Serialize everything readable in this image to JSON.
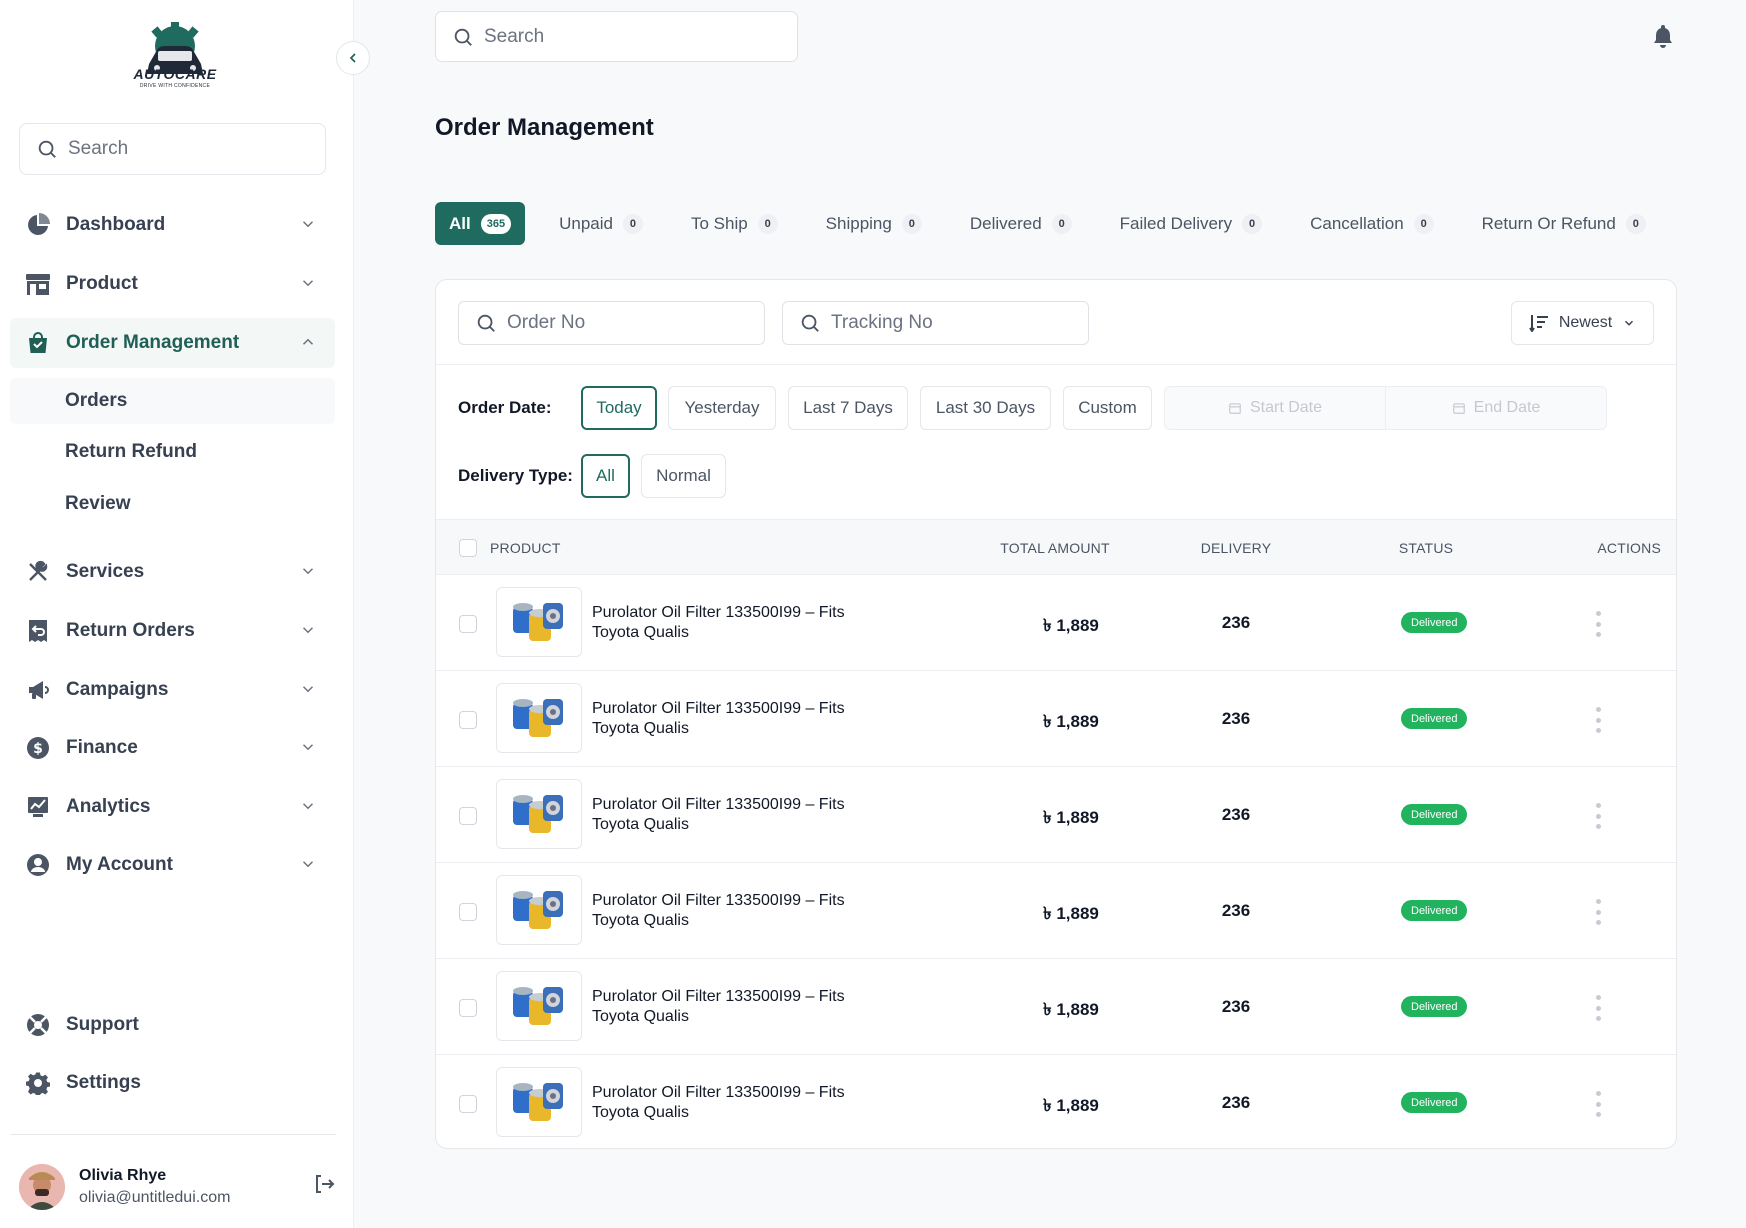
{
  "brand": {
    "name": "AUTOCARE",
    "tagline": "DRIVE WITH CONFIDENCE"
  },
  "sidebar": {
    "search_placeholder": "Search",
    "items": [
      {
        "label": "Dashboard"
      },
      {
        "label": "Product"
      },
      {
        "label": "Order Management"
      },
      {
        "label": "Services"
      },
      {
        "label": "Return Orders"
      },
      {
        "label": "Campaigns"
      },
      {
        "label": "Finance"
      },
      {
        "label": "Analytics"
      },
      {
        "label": "My Account"
      }
    ],
    "sub_items": [
      {
        "label": "Orders"
      },
      {
        "label": "Return Refund"
      },
      {
        "label": "Review"
      }
    ],
    "bottom": [
      {
        "label": "Support"
      },
      {
        "label": "Settings"
      }
    ],
    "user": {
      "name": "Olivia Rhye",
      "email": "olivia@untitledui.com"
    }
  },
  "header": {
    "search_placeholder": "Search"
  },
  "page": {
    "title": "Order Management"
  },
  "tabs": [
    {
      "label": "All",
      "count": "365"
    },
    {
      "label": "Unpaid",
      "count": "0"
    },
    {
      "label": "To Ship",
      "count": "0"
    },
    {
      "label": "Shipping",
      "count": "0"
    },
    {
      "label": "Delivered",
      "count": "0"
    },
    {
      "label": "Failed Delivery",
      "count": "0"
    },
    {
      "label": "Cancellation",
      "count": "0"
    },
    {
      "label": "Return Or Refund",
      "count": "0"
    }
  ],
  "filters": {
    "order_no_placeholder": "Order No",
    "tracking_no_placeholder": "Tracking No",
    "sort_label": "Newest",
    "order_date_label": "Order Date:",
    "date_options": [
      "Today",
      "Yesterday",
      "Last 7 Days",
      "Last 30 Days",
      "Custom"
    ],
    "start_date": "Start Date",
    "end_date": "End Date",
    "delivery_type_label": "Delivery Type:",
    "delivery_options": [
      "All",
      "Normal"
    ]
  },
  "table": {
    "headers": {
      "product": "PRODUCT",
      "total_amount": "TOTAL AMOUNT",
      "delivery": "DELIVERY",
      "status": "STATUS",
      "actions": "ACTIONS"
    },
    "rows": [
      {
        "product": "Purolator Oil Filter 133500I99 – Fits Toyota Qualis",
        "amount": "৳ 1,889",
        "delivery": "236",
        "status": "Delivered"
      },
      {
        "product": "Purolator Oil Filter 133500I99 – Fits Toyota Qualis",
        "amount": "৳ 1,889",
        "delivery": "236",
        "status": "Delivered"
      },
      {
        "product": "Purolator Oil Filter 133500I99 – Fits Toyota Qualis",
        "amount": "৳ 1,889",
        "delivery": "236",
        "status": "Delivered"
      },
      {
        "product": "Purolator Oil Filter 133500I99 – Fits Toyota Qualis",
        "amount": "৳ 1,889",
        "delivery": "236",
        "status": "Delivered"
      },
      {
        "product": "Purolator Oil Filter 133500I99 – Fits Toyota Qualis",
        "amount": "৳ 1,889",
        "delivery": "236",
        "status": "Delivered"
      },
      {
        "product": "Purolator Oil Filter 133500I99 – Fits Toyota Qualis",
        "amount": "৳ 1,889",
        "delivery": "236",
        "status": "Delivered"
      }
    ]
  },
  "colors": {
    "accent": "#1f6b5f",
    "status_delivered": "#22b35e"
  }
}
